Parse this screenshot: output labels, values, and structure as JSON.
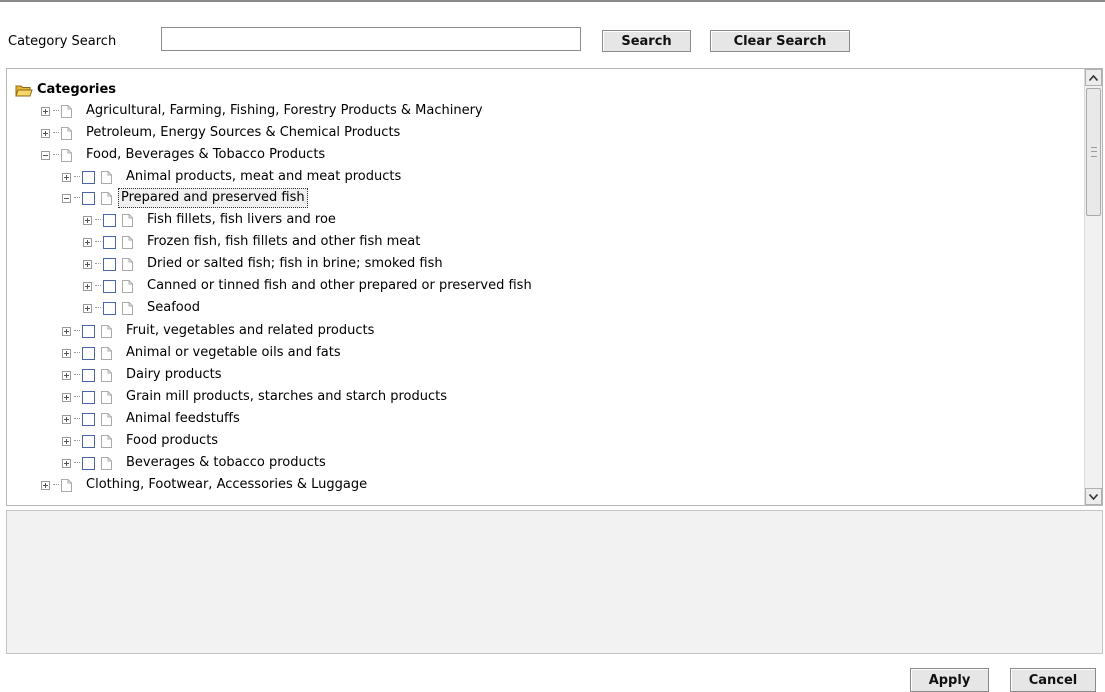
{
  "search": {
    "label": "Category Search",
    "value": "",
    "placeholder": "",
    "search_button": "Search",
    "clear_button": "Clear Search"
  },
  "tree": {
    "root": "Categories",
    "items": [
      {
        "label": "Agricultural, Farming, Fishing, Forestry Products & Machinery"
      },
      {
        "label": "Petroleum, Energy Sources & Chemical Products"
      },
      {
        "label": "Food, Beverages & Tobacco Products"
      },
      {
        "label": "Animal products, meat and meat products"
      },
      {
        "label": "Prepared and preserved fish"
      },
      {
        "label": "Fish fillets, fish livers and roe"
      },
      {
        "label": "Frozen fish, fish fillets and other fish meat"
      },
      {
        "label": "Dried or salted fish; fish in brine; smoked fish"
      },
      {
        "label": "Canned or tinned fish and other prepared or preserved fish"
      },
      {
        "label": "Seafood"
      },
      {
        "label": "Fruit, vegetables and related products"
      },
      {
        "label": "Animal or vegetable oils and fats"
      },
      {
        "label": "Dairy products"
      },
      {
        "label": "Grain mill products, starches and starch products"
      },
      {
        "label": "Animal feedstuffs"
      },
      {
        "label": "Food products"
      },
      {
        "label": "Beverages & tobacco products"
      },
      {
        "label": "Clothing, Footwear, Accessories & Luggage"
      }
    ]
  },
  "footer": {
    "apply_button": "Apply",
    "cancel_button": "Cancel"
  },
  "icons": {
    "folder": "folder-open-icon",
    "document": "document-icon",
    "expand": "plus-expander-icon",
    "collapse": "minus-expander-icon"
  },
  "colors": {
    "checkbox_border": "#4a66a8",
    "button_bg": "#e6e6e6",
    "detail_panel_bg": "#f2f2f2"
  }
}
